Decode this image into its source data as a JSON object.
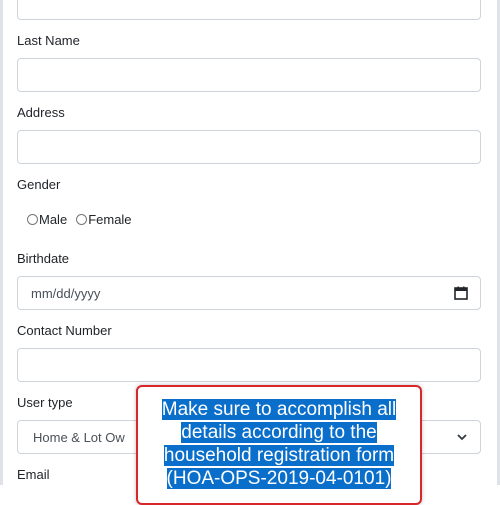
{
  "form": {
    "last_name_label": "Last Name",
    "address_label": "Address",
    "gender_label": "Gender",
    "gender_options": [
      "Male",
      "Female"
    ],
    "birthdate_label": "Birthdate",
    "birthdate_placeholder": "mm/dd/yyyy",
    "contact_label": "Contact Number",
    "user_type_label": "User type",
    "user_type_value": "Home & Lot Ow",
    "email_label": "Email"
  },
  "tooltip": {
    "text": "Make sure to accomplish all details according to the household registration form (HOA-OPS-2019-04-0101)"
  },
  "colors": {
    "tooltip_border": "#d9262b",
    "tooltip_highlight": "#0a6ecb"
  }
}
